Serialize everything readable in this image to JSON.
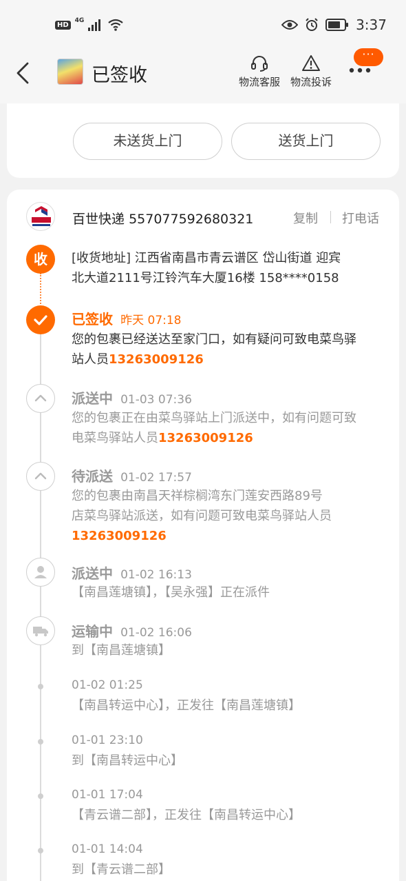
{
  "status_bar": {
    "hd": "HD",
    "network": "4G",
    "time": "3:37"
  },
  "header": {
    "title": "已签收",
    "service_label": "物流客服",
    "complaint_label": "物流投诉",
    "more_badge": "···"
  },
  "delivery_options": {
    "not_to_door": "未送货上门",
    "to_door": "送货上门"
  },
  "carrier": {
    "name": "百世快递",
    "tracking_number": "557077592680321",
    "copy_label": "复制",
    "call_label": "打电话",
    "logo_text": "百世快递"
  },
  "address": {
    "node_label": "收",
    "line1": "[收货地址] 江西省南昌市青云谱区 岱山街道   迎宾",
    "line2": "北大道2111号江铃汽车大厦16楼 158****0158"
  },
  "events": [
    {
      "status": "已签收",
      "time": "昨天  07:18",
      "line1": "您的包裹已经送达至家门口，如有疑问可致电菜鸟驿",
      "line2_prefix": "站人员",
      "phone": "13263009126"
    },
    {
      "status": "派送中",
      "time": "01-03  07:36",
      "line1": "您的包裹正在由菜鸟驿站上门派送中，如有问题可致",
      "line2_prefix": "电菜鸟驿站人员",
      "phone": "13263009126"
    },
    {
      "status": "待派送",
      "time": "01-02  17:57",
      "line1": "您的包裹由南昌天祥棕榈湾东门莲安西路89号",
      "line2": "店菜鸟驿站派送，如有问题可致电菜鸟驿站人员",
      "phone": "13263009126"
    },
    {
      "status": "派送中",
      "time": "01-02  16:13",
      "line1": "【南昌莲塘镇】，【吴永强】正在派件"
    },
    {
      "status": "运输中",
      "time": "01-02  16:06",
      "line1": "到【南昌莲塘镇】"
    },
    {
      "time": "01-02  01:25",
      "line1": "【南昌转运中心】，正发往【南昌莲塘镇】"
    },
    {
      "time": "01-01  23:10",
      "line1": "到【南昌转运中心】"
    },
    {
      "time": "01-01  17:04",
      "line1": "【青云谱二部】，正发往【南昌转运中心】"
    },
    {
      "time": "01-01  14:04",
      "line1": "到【青云谱二部】"
    }
  ],
  "colors": {
    "accent": "#ff6a00",
    "muted": "#999999",
    "background": "#f2f2f2"
  }
}
